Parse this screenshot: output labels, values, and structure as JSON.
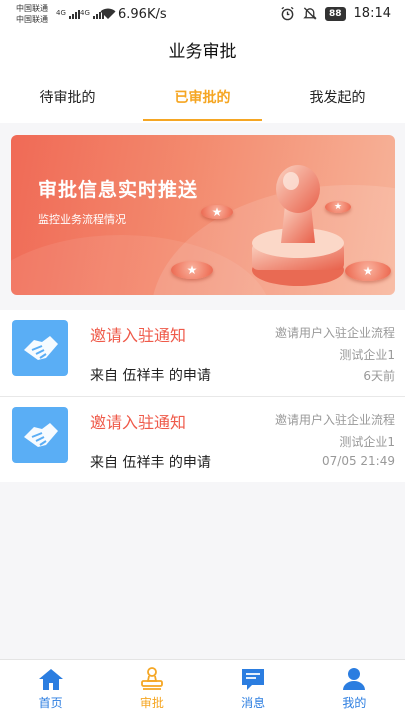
{
  "status_bar": {
    "carrier_1": "中国联通",
    "carrier_2": "中国联通",
    "signal_1": "4G",
    "signal_2": "4G",
    "net_speed": "6.96K/s",
    "battery": "88",
    "time": "18:14"
  },
  "header": {
    "title": "业务审批"
  },
  "tabs": [
    {
      "label": "待审批的",
      "active": false
    },
    {
      "label": "已审批的",
      "active": true
    },
    {
      "label": "我发起的",
      "active": false
    }
  ],
  "banner": {
    "title": "审批信息实时推送",
    "subtitle": "监控业务流程情况"
  },
  "items": [
    {
      "title": "邀请入驻通知",
      "from": "来自 伍祥丰 的申请",
      "flow": "邀请用户入驻企业流程",
      "company": "测试企业1",
      "time": "6天前"
    },
    {
      "title": "邀请入驻通知",
      "from": "来自 伍祥丰 的申请",
      "flow": "邀请用户入驻企业流程",
      "company": "测试企业1",
      "time": "07/05 21:49"
    }
  ],
  "bottom_nav": [
    {
      "label": "首页",
      "icon": "home-icon"
    },
    {
      "label": "审批",
      "icon": "stamp-icon",
      "active": true
    },
    {
      "label": "消息",
      "icon": "message-icon"
    },
    {
      "label": "我的",
      "icon": "user-icon"
    }
  ],
  "colors": {
    "accent": "#f5a623",
    "nav_blue": "#2b7de0",
    "title_red": "#ef5a4a",
    "icon_blue": "#5aaef5"
  }
}
